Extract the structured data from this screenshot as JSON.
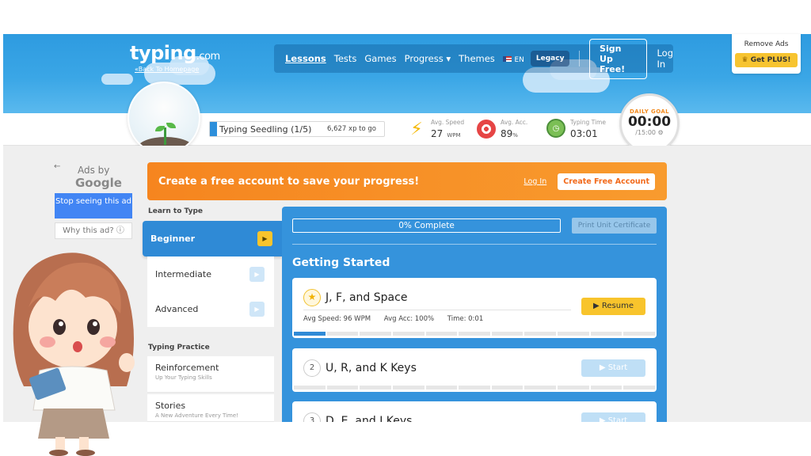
{
  "header": {
    "logo_main": "typing",
    "logo_suffix": ".com",
    "back_link": "«Back To Homepage",
    "nav": [
      "Lessons",
      "Tests",
      "Games",
      "Progress ▾",
      "Themes"
    ],
    "language": "EN",
    "legacy": "Legacy",
    "signup": "Sign Up Free!",
    "login": "Log In"
  },
  "remove_ads": {
    "title": "Remove Ads",
    "button": "Get PLUS!"
  },
  "stats": {
    "seedling_label": "Typing Seedling (1/5)",
    "seedling_progress": 0.04,
    "xp_to_go": "6,627 xp to go",
    "speed_label": "Avg. Speed",
    "speed_value": "27",
    "speed_unit": "WPM",
    "acc_label": "Avg. Acc.",
    "acc_value": "89",
    "acc_unit": "%",
    "time_label": "Typing Time",
    "time_value": "03:01",
    "goal_label": "DAILY GOAL",
    "goal_value": "00:00",
    "goal_target": "/15:00 ⚙"
  },
  "ads": {
    "ads_by": "Ads by",
    "google": "Google",
    "stop": "Stop seeing this ad",
    "why": "Why this ad? ⓘ"
  },
  "banner": {
    "message": "Create a free account to save your progress!",
    "login": "Log In",
    "create": "Create Free Account"
  },
  "sidebar": {
    "learn_title": "Learn to Type",
    "levels": [
      "Beginner",
      "Intermediate",
      "Advanced"
    ],
    "practice_title": "Typing Practice",
    "practice": [
      {
        "name": "Reinforcement",
        "desc": "Up Your Typing Skills"
      },
      {
        "name": "Stories",
        "desc": "A New Adventure Every Time!"
      }
    ]
  },
  "main": {
    "progress_text": "0% Complete",
    "print_button": "Print Unit Certificate",
    "section_title": "Getting Started",
    "lessons": [
      {
        "num": "★",
        "title": "J, F, and Space",
        "button": "▶  Resume",
        "speed": "Avg Speed: 96 WPM",
        "acc": "Avg Acc: 100%",
        "time": "Time: 0:01",
        "done_segments": 1
      },
      {
        "num": "2",
        "title": "U, R, and K Keys",
        "button": "▶  Start"
      },
      {
        "num": "3",
        "title": "D, E, and I Keys",
        "button": "▶  Start"
      }
    ]
  },
  "colors": {
    "header_blue": "#3aa6e6",
    "orange": "#f6851f",
    "panel_blue": "#3593dc",
    "yellow": "#f8c42c"
  }
}
